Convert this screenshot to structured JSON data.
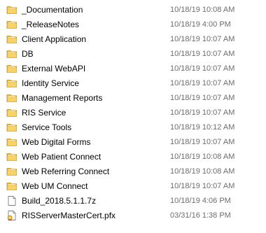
{
  "files": [
    {
      "name": "_Documentation",
      "modified": "10/18/19 10:08 AM",
      "icon": "folder-icon"
    },
    {
      "name": "_ReleaseNotes",
      "modified": "10/18/19 4:00 PM",
      "icon": "folder-icon"
    },
    {
      "name": "Client Application",
      "modified": "10/18/19 10:07 AM",
      "icon": "folder-icon"
    },
    {
      "name": "DB",
      "modified": "10/18/19 10:07 AM",
      "icon": "folder-icon"
    },
    {
      "name": "External WebAPI",
      "modified": "10/18/19 10:07 AM",
      "icon": "folder-icon"
    },
    {
      "name": "Identity Service",
      "modified": "10/18/19 10:07 AM",
      "icon": "folder-icon"
    },
    {
      "name": "Management Reports",
      "modified": "10/18/19 10:07 AM",
      "icon": "folder-icon"
    },
    {
      "name": "RIS Service",
      "modified": "10/18/19 10:07 AM",
      "icon": "folder-icon"
    },
    {
      "name": "Service Tools",
      "modified": "10/18/19 10:12 AM",
      "icon": "folder-icon"
    },
    {
      "name": "Web Digital Forms",
      "modified": "10/18/19 10:07 AM",
      "icon": "folder-icon"
    },
    {
      "name": "Web Patient Connect",
      "modified": "10/18/19 10:08 AM",
      "icon": "folder-icon"
    },
    {
      "name": "Web Referring Connect",
      "modified": "10/18/19 10:08 AM",
      "icon": "folder-icon"
    },
    {
      "name": "Web UM Connect",
      "modified": "10/18/19 10:07 AM",
      "icon": "folder-icon"
    },
    {
      "name": "Build_2018.5.1.1.7z",
      "modified": "10/18/19 4:06 PM",
      "icon": "file-icon"
    },
    {
      "name": "RISServerMasterCert.pfx",
      "modified": "03/31/16 1:38 PM",
      "icon": "certificate-file-icon"
    }
  ],
  "colors": {
    "folder_body": "#e8b93d",
    "folder_front": "#f7d36b",
    "folder_edge": "#c69524",
    "date_text": "#6d6d6d"
  }
}
